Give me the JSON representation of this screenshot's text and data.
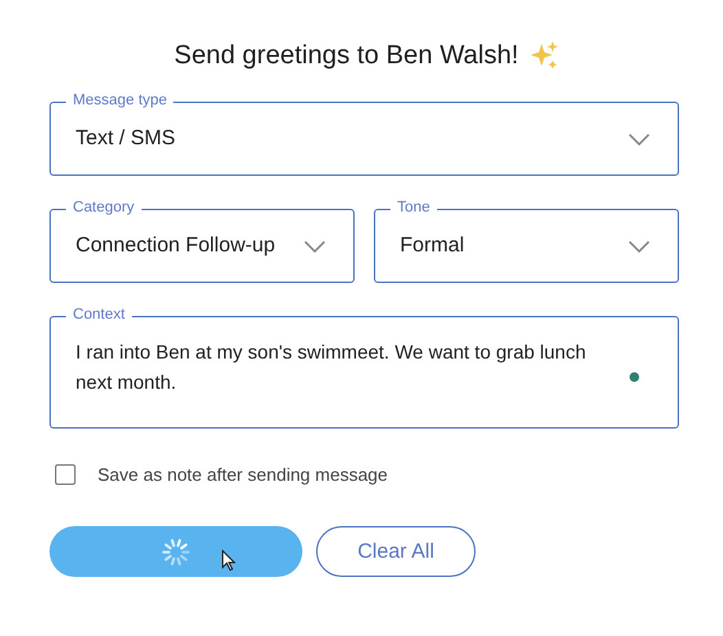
{
  "title": "Send greetings to Ben Walsh!",
  "fields": [
    {
      "kind": "select",
      "label": "Message type",
      "value": "Text / SMS"
    },
    {
      "kind": "select",
      "label": "Category",
      "value": "Connection Follow-up"
    },
    {
      "kind": "select",
      "label": "Tone",
      "value": "Formal"
    },
    {
      "kind": "textarea",
      "label": "Context",
      "value": "I ran into Ben at my son's swimmeet. We want to grab lunch next month."
    }
  ],
  "checkbox": {
    "label": "Save as note after sending message",
    "checked": false
  },
  "buttons": [
    {
      "kind": "primary",
      "loading": true
    },
    {
      "kind": "outline",
      "label": "Clear All"
    }
  ]
}
